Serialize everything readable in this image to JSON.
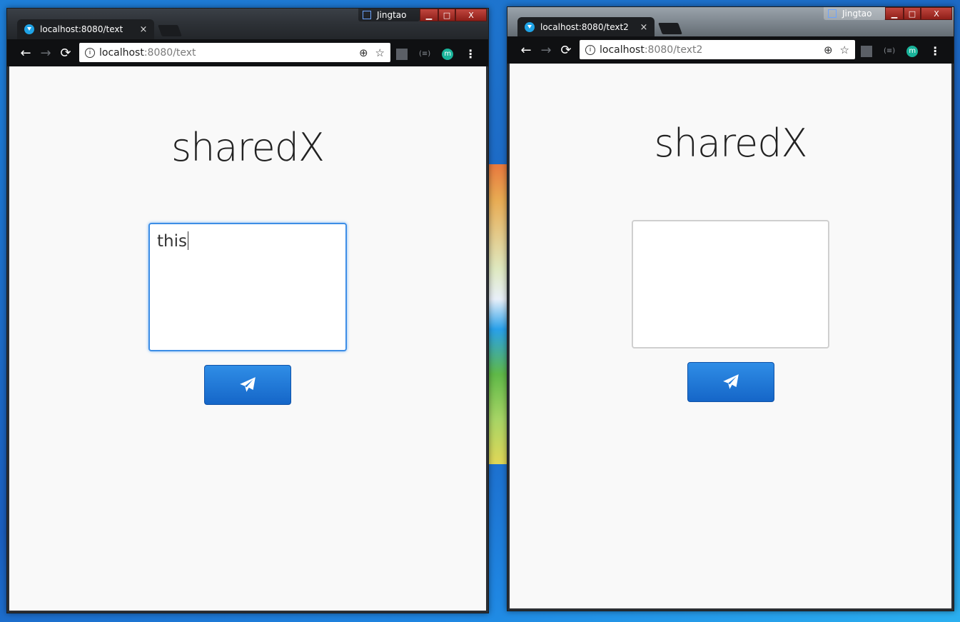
{
  "windows": [
    {
      "tab": {
        "title": "localhost:8080/text",
        "close": "×"
      },
      "profile": "Jingtao",
      "controls": {
        "minimize": "▁",
        "maximize": "□",
        "close": "X"
      },
      "address": {
        "host": "localhost",
        "path": ":8080/text"
      },
      "app": {
        "title": "sharedX",
        "text_value": "this"
      }
    },
    {
      "tab": {
        "title": "localhost:8080/text2",
        "close": "×"
      },
      "profile": "Jingtao",
      "controls": {
        "minimize": "▁",
        "maximize": "□",
        "close": "X"
      },
      "address": {
        "host": "localhost",
        "path": ":8080/text2"
      },
      "app": {
        "title": "sharedX",
        "text_value": ""
      }
    }
  ],
  "icons": {
    "back": "←",
    "forward": "→",
    "reload": "⟳",
    "info": "i",
    "zoom": "⊕",
    "bookmark": "☆",
    "ext_badge": "(≡)",
    "ext_m": "m",
    "menu": "⋮"
  },
  "colors": {
    "accent": "#1a74d6",
    "focus_border": "#3d8ee6",
    "page_bg": "#f9f9f9"
  }
}
